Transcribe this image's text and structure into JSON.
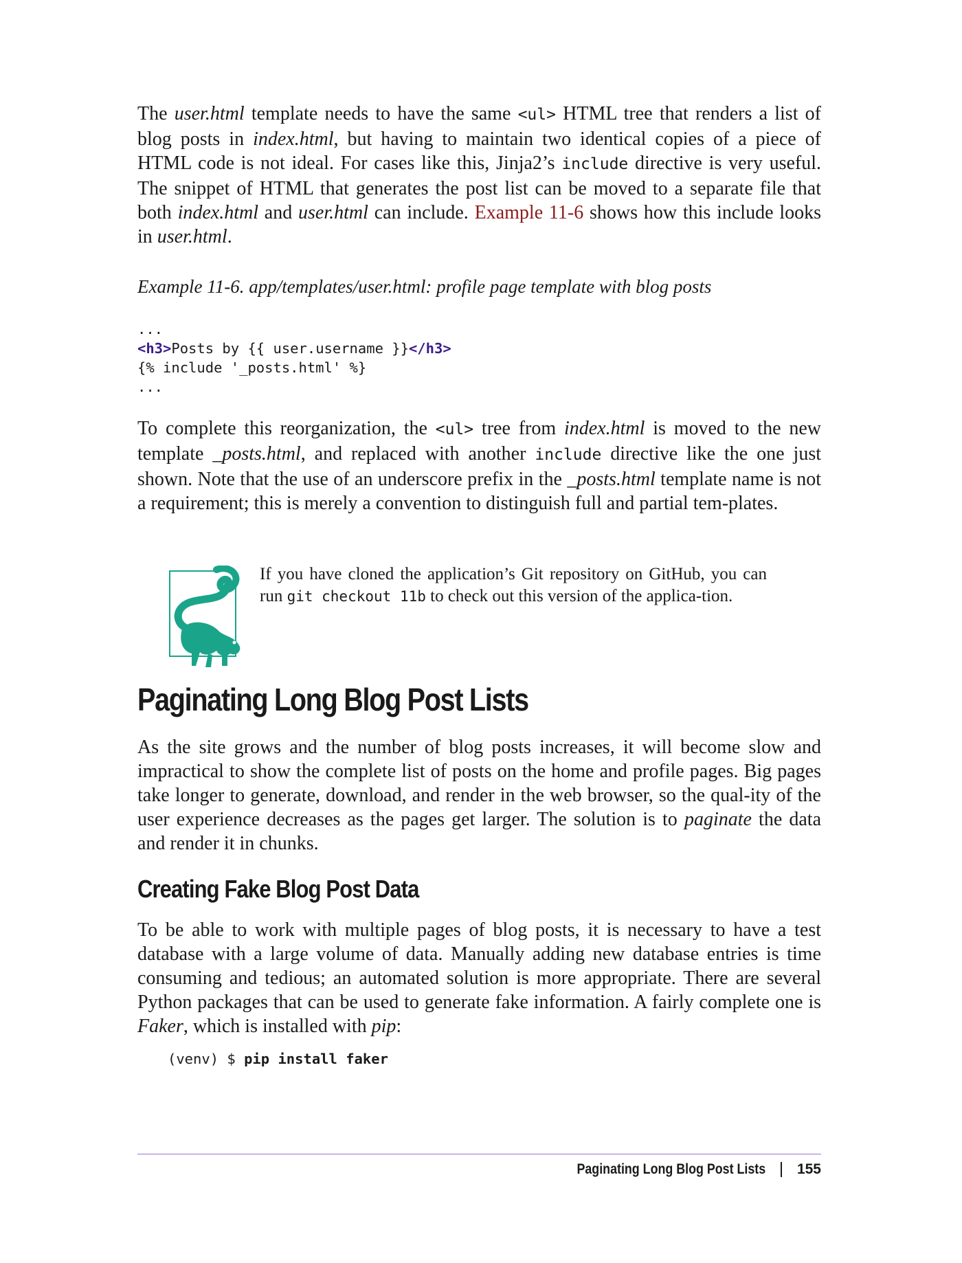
{
  "paragraph1": {
    "t1": "The ",
    "e1": "user.html",
    "t2": " template needs to have the same ",
    "c1": "<ul>",
    "t3": " HTML tree that renders a list of blog posts in ",
    "e2": "index.html",
    "t4": ", but having to maintain two identical copies of a piece of HTML code is not ideal. For cases like this, Jinja2’s ",
    "c2": "include",
    "t5": " directive is very useful. The snippet of HTML that generates the post list can be moved to a separate file that both ",
    "e3": "index.html",
    "t6": " and ",
    "e4": "user.html",
    "t7": " can include. ",
    "link": "Example 11-6",
    "t8": " shows how this include looks in ",
    "e5": "user.html",
    "t9": "."
  },
  "example_caption": "Example 11-6. app/templates/user.html: profile page template with blog posts",
  "code1": {
    "l1": "...",
    "tag_open": "<h3>",
    "l2": "Posts by {{ user.username }}",
    "tag_close": "</h3>",
    "l3": "{% include '_posts.html' %}",
    "l4": "..."
  },
  "paragraph2": {
    "t1": "To complete this reorganization, the ",
    "c1": "<ul>",
    "t2": " tree from ",
    "e1": "index.html",
    "t3": " is moved to the new template ",
    "e2": "_posts.html",
    "t4": ", and replaced with another ",
    "c2": "include",
    "t5": " directive like the one just shown. Note that the use of an underscore prefix in the ",
    "e3": "_posts.html",
    "t6": " template name is not a requirement; this is merely a convention to distinguish full and partial tem‐plates."
  },
  "note": {
    "icon": "lemur-icon",
    "t1": "If you have cloned the application’s Git repository on GitHub, you can run ",
    "c1": "git checkout 11b",
    "t2": " to check out this version of the applica‐tion."
  },
  "section_heading": "Paginating Long Blog Post Lists",
  "paragraph3": {
    "t1": "As the site grows and the number of blog posts increases, it will become slow and impractical to show the complete list of posts on the home and profile pages. Big pages take longer to generate, download, and render in the web browser, so the qual‐ity of the user experience decreases as the pages get larger. The solution is to ",
    "e1": "paginate",
    "t2": " the data and render it in chunks."
  },
  "subsection_heading": "Creating Fake Blog Post Data",
  "paragraph4": {
    "t1": "To be able to work with multiple pages of blog posts, it is necessary to have a test database with a large volume of data. Manually adding new database entries is time consuming and tedious; an automated solution is more appropriate. There are several Python packages that can be used to generate fake information. A fairly complete one is ",
    "e1": "Faker",
    "t2": ", which is installed with ",
    "e2": "pip",
    "t3": ":"
  },
  "code2": {
    "prompt": "(venv) $ ",
    "command": "pip install faker"
  },
  "footer": {
    "running_title": "Paginating Long Blog Post Lists",
    "page_number": "155"
  },
  "colors": {
    "link": "#8b1a1a",
    "code_tag": "#3a1c8c",
    "lemur": "#1aa58a",
    "footer_rule": "#9b72c8"
  }
}
